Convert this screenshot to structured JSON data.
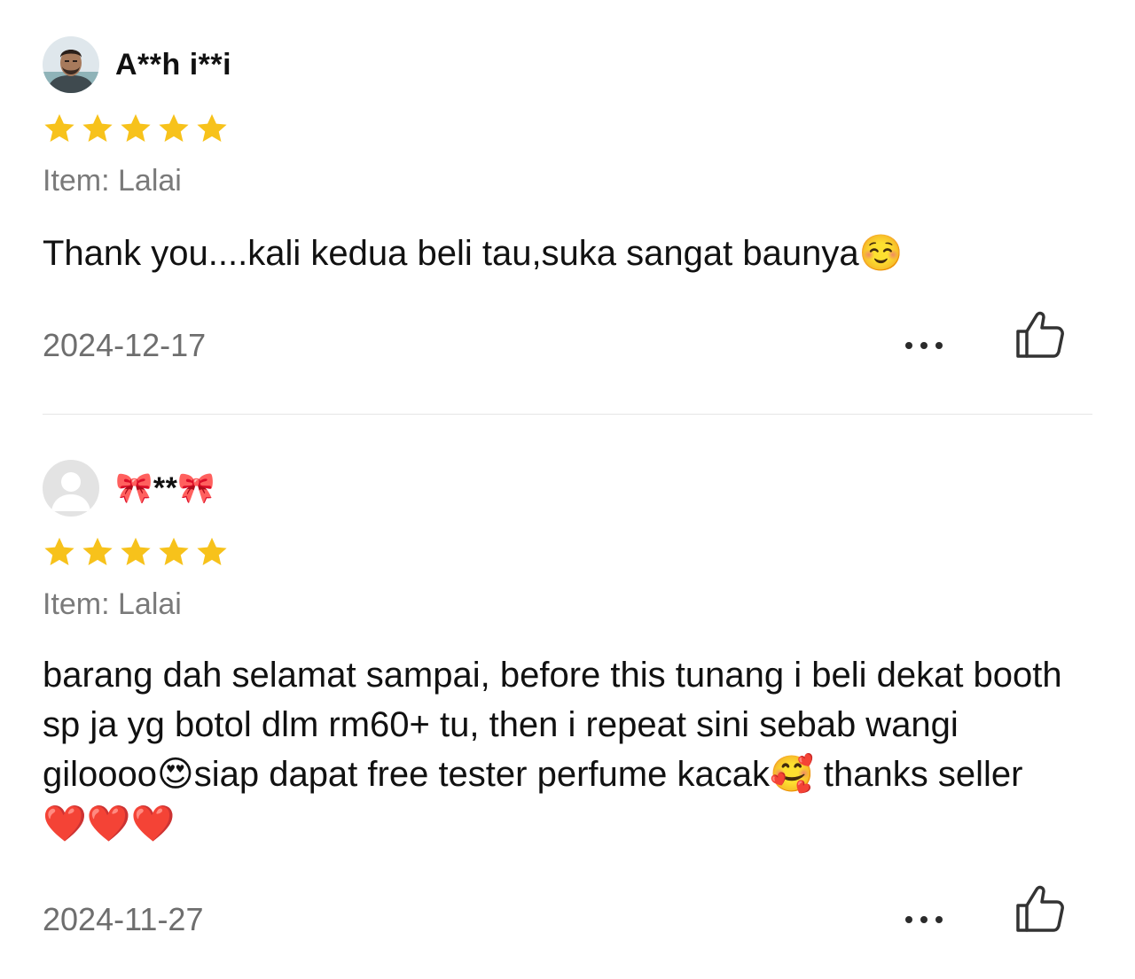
{
  "reviews": [
    {
      "username": "A**h i**i",
      "avatar_icon": "user-photo-avatar",
      "rating": 5,
      "max_rating": 5,
      "item": "Item: Lalai",
      "comment": "Thank you....kali kedua beli tau,suka sangat baunya☺️",
      "date": "2024-12-17",
      "more_icon": "ellipsis-icon",
      "like_icon": "thumbs-up-icon"
    },
    {
      "username": "🎀**🎀",
      "avatar_icon": "default-user-avatar",
      "rating": 5,
      "max_rating": 5,
      "item": "Item: Lalai",
      "comment": "barang dah selamat sampai, before this tunang i beli dekat booth sp ja yg botol dlm rm60+ tu, then i repeat sini sebab wangi giloooo😍siap dapat free tester perfume kacak🥰 thanks seller❤️❤️❤️",
      "date": "2024-11-27",
      "more_icon": "ellipsis-icon",
      "like_icon": "thumbs-up-icon"
    }
  ],
  "colors": {
    "star": "#f7c21b",
    "text": "#111111",
    "muted": "#7a7a7a",
    "divider": "#e6e6e6"
  }
}
